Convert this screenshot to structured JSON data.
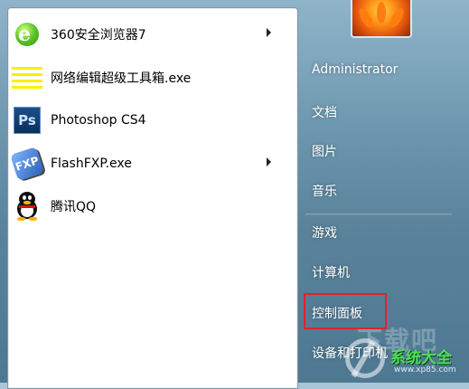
{
  "programs": [
    {
      "label": "360安全浏览器7",
      "icon": "360-browser-icon",
      "has_submenu": true
    },
    {
      "label": "网络编辑超级工具箱.exe",
      "icon": "toolbox-icon",
      "has_submenu": false
    },
    {
      "label": "Photoshop CS4",
      "icon": "photoshop-icon",
      "has_submenu": false
    },
    {
      "label": "FlashFXP.exe",
      "icon": "flashfxp-icon",
      "has_submenu": true
    },
    {
      "label": "腾讯QQ",
      "icon": "qq-icon",
      "has_submenu": false
    }
  ],
  "icon_text": {
    "ie": "e",
    "ps": "Ps",
    "fxp": "FXP"
  },
  "right_menu": {
    "user": "Administrator",
    "items": [
      "文档",
      "图片",
      "音乐",
      "游戏",
      "计算机",
      "控制面板",
      "设备和打印机"
    ]
  },
  "watermark": {
    "bg_text": "下载吧",
    "text": "系统大全",
    "url": "www.xp85.com"
  },
  "colors": {
    "highlight": "#e0222b",
    "accent_green": "#4fe05a"
  }
}
